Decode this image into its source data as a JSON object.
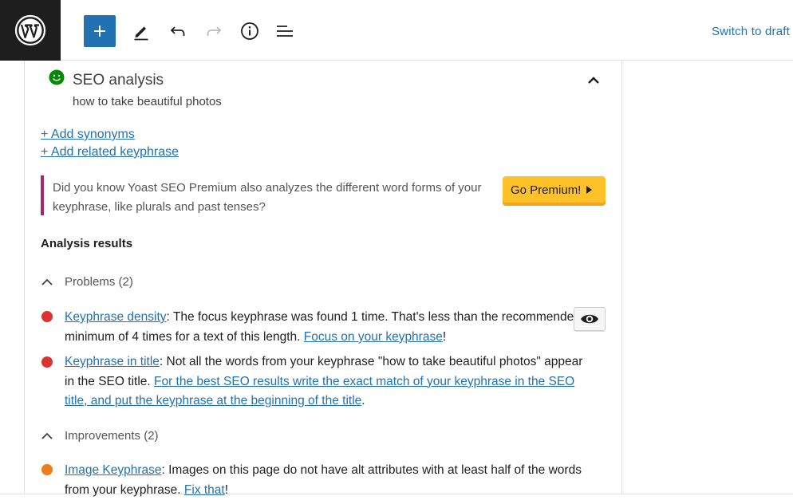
{
  "topbar": {
    "logo_icon": "wordpress-logo-icon",
    "add_icon": "plus-icon",
    "tools": [
      "pencil-icon",
      "undo-icon",
      "redo-icon",
      "info-icon",
      "list-view-icon"
    ],
    "switch_to_draft": "Switch to draft"
  },
  "seo": {
    "status_icon": "smiley-icon",
    "status_color": "#008a00",
    "title": "SEO analysis",
    "keyphrase": "how to take beautiful photos",
    "add_synonyms": "+ Add synonyms",
    "add_related": "+ Add related keyphrase"
  },
  "premium": {
    "text": "Did you know Yoast SEO Premium also analyzes the different word forms of your keyphrase, like plurals and past tenses?",
    "button": "Go Premium!",
    "accent": "#a4286a",
    "button_color": "#fec228"
  },
  "analysis": {
    "title": "Analysis results",
    "problems": {
      "label": "Problems (2)",
      "items": [
        {
          "link": "Keyphrase density",
          "text": ": The focus keyphrase was found 1 time. That's less than the recommended minimum of 4 times for a text of this length. ",
          "action": "Focus on your keyphrase",
          "end": "!",
          "color": "#dc3232"
        },
        {
          "link": "Keyphrase in title",
          "text": ": Not all the words from your keyphrase \"how to take beautiful photos\" appear in the SEO title. ",
          "action": "For the best SEO results write the exact match of your keyphrase in the SEO title, and put the keyphrase at the beginning of the title",
          "end": ".",
          "color": "#dc3232"
        }
      ]
    },
    "improvements": {
      "label": "Improvements (2)",
      "items": [
        {
          "link": "Image Keyphrase",
          "text": ": Images on this page do not have alt attributes with at least half of the words from your keyphrase. ",
          "action": "Fix that",
          "end": "!",
          "color": "#ee7c1b"
        }
      ]
    }
  }
}
